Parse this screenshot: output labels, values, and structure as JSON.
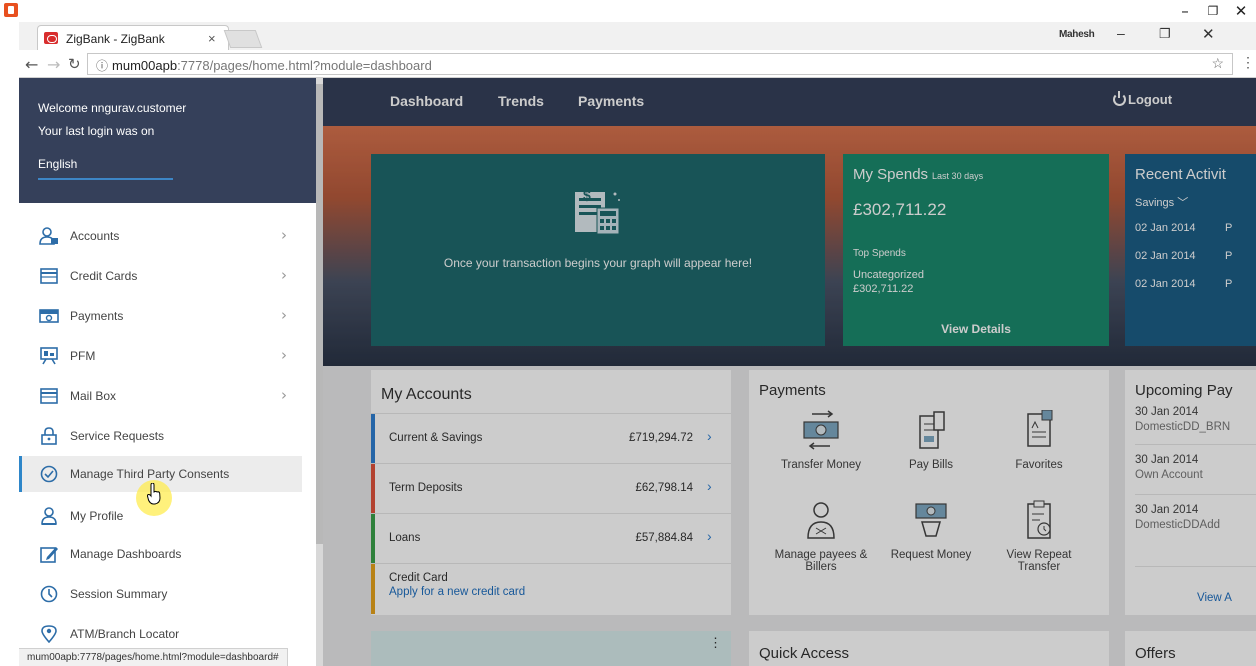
{
  "browser": {
    "tab_title": "ZigBank - ZigBank",
    "tab_close": "×",
    "profile_name": "Mahesh",
    "url_host": "mum00apb",
    "url_path": ":7778/pages/home.html?module=dashboard",
    "status_url": "mum00apb:7778/pages/home.html?module=dashboard#"
  },
  "topnav": {
    "items": [
      "Dashboard",
      "Trends",
      "Payments"
    ],
    "logout": "Logout"
  },
  "sidebar": {
    "welcome": "Welcome nngurav.customer",
    "last_login": "Your last login was on",
    "language": "English",
    "items": [
      {
        "label": "Accounts",
        "icon": "accounts-icon",
        "has_submenu": true
      },
      {
        "label": "Credit Cards",
        "icon": "credit-card-icon",
        "has_submenu": true
      },
      {
        "label": "Payments",
        "icon": "payments-icon",
        "has_submenu": true
      },
      {
        "label": "PFM",
        "icon": "pfm-icon",
        "has_submenu": true
      },
      {
        "label": "Mail Box",
        "icon": "mailbox-icon",
        "has_submenu": true
      },
      {
        "label": "Service Requests",
        "icon": "lock-icon",
        "has_submenu": false
      },
      {
        "label": "Manage Third Party Consents",
        "icon": "check-circle-icon",
        "has_submenu": false
      },
      {
        "label": "My Profile",
        "icon": "profile-icon",
        "has_submenu": false
      },
      {
        "label": "Manage Dashboards",
        "icon": "edit-icon",
        "has_submenu": false
      },
      {
        "label": "Session Summary",
        "icon": "clock-icon",
        "has_submenu": false
      },
      {
        "label": "ATM/Branch Locator",
        "icon": "location-pin-icon",
        "has_submenu": false
      }
    ]
  },
  "graph_card": {
    "message": "Once your transaction begins your graph will appear here!"
  },
  "spends": {
    "title": "My Spends",
    "range": "Last 30 days",
    "amount": "£302,711.22",
    "top_spends_label": "Top Spends",
    "category": "Uncategorized",
    "category_amount": "£302,711.22",
    "view_details": "View Details"
  },
  "activity": {
    "title": "Recent Activit",
    "filter": "Savings",
    "rows": [
      {
        "date": "02 Jan 2014",
        "p": "P"
      },
      {
        "date": "02 Jan 2014",
        "p": "P"
      },
      {
        "date": "02 Jan 2014",
        "p": "P"
      }
    ]
  },
  "accounts": {
    "title": "My Accounts",
    "rows": [
      {
        "name": "Current & Savings",
        "amount": "£719,294.72",
        "color": "#2f7fd1"
      },
      {
        "name": "Term Deposits",
        "amount": "£62,798.14",
        "color": "#e0533c"
      },
      {
        "name": "Loans",
        "amount": "£57,884.84",
        "color": "#3aa14a"
      }
    ],
    "credit_card_label": "Credit Card",
    "credit_card_link": "Apply for a new credit card",
    "credit_card_color": "#e6a31c"
  },
  "payments": {
    "title": "Payments",
    "items": [
      {
        "label": "Transfer Money",
        "icon": "transfer-money-icon"
      },
      {
        "label": "Pay Bills",
        "icon": "pay-bills-icon"
      },
      {
        "label": "Favorites",
        "icon": "favorites-icon"
      },
      {
        "label": "Manage payees & Billers",
        "icon": "payees-icon"
      },
      {
        "label": "Request Money",
        "icon": "request-money-icon"
      },
      {
        "label": "View Repeat Transfer",
        "icon": "repeat-transfer-icon"
      }
    ]
  },
  "upcoming": {
    "title": "Upcoming Pay",
    "rows": [
      {
        "date": "30 Jan 2014",
        "desc": "DomesticDD_BRN"
      },
      {
        "date": "30 Jan 2014",
        "desc": "Own Account"
      },
      {
        "date": "30 Jan 2014",
        "desc": "DomesticDDAdd"
      }
    ],
    "view_all": "View A"
  },
  "bottom": {
    "goals_dots": "⋮",
    "quick_access": "Quick Access",
    "offers": "Offers"
  },
  "colors": {
    "header": "#35405a",
    "accent": "#2e86c9",
    "spends_card": "#1b8a6d",
    "graph_card": "#1f6a6d",
    "activity_card": "#1c5e86"
  }
}
